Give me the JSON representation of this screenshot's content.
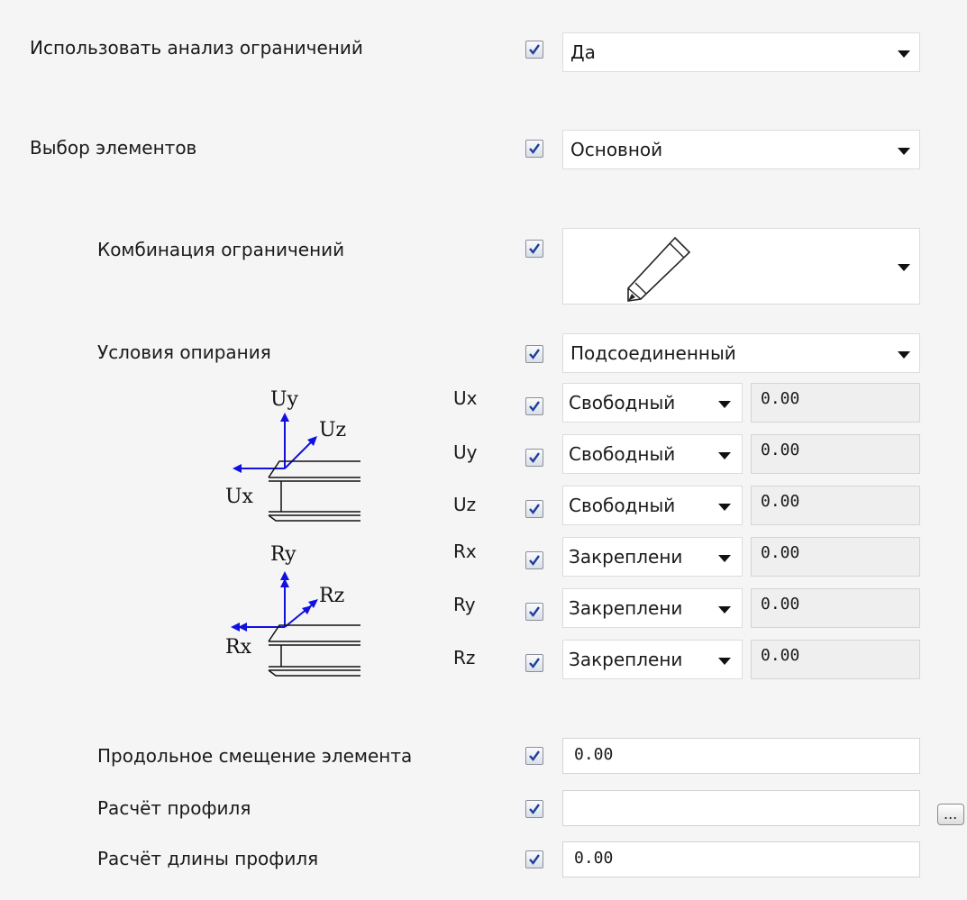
{
  "rows": {
    "use_analysis": {
      "label": "Использовать анализ ограничений",
      "value": "Да"
    },
    "element_selection": {
      "label": "Выбор элементов",
      "value": "Основной"
    },
    "restraint_combination": {
      "label": "Комбинация ограничений",
      "icon": "pencil-icon"
    },
    "support_conditions": {
      "label": "Условия опирания",
      "value": "Подсоединенный"
    },
    "longitudinal_offset": {
      "label": "Продольное смещение элемента",
      "value": "0.00"
    },
    "profile_calc": {
      "label": "Расчёт профиля",
      "value": "",
      "button": "..."
    },
    "profile_length_calc": {
      "label": "Расчёт длины профиля",
      "value": "0.00"
    }
  },
  "dofs": [
    {
      "name": "Ux",
      "condition": "Свободный",
      "value": "0.00"
    },
    {
      "name": "Uy",
      "condition": "Свободный",
      "value": "0.00"
    },
    {
      "name": "Uz",
      "condition": "Свободный",
      "value": "0.00"
    },
    {
      "name": "Rx",
      "condition": "Закреплени",
      "value": "0.00"
    },
    {
      "name": "Ry",
      "condition": "Закреплени",
      "value": "0.00"
    },
    {
      "name": "Rz",
      "condition": "Закреплени",
      "value": "0.00"
    }
  ],
  "diagram": {
    "translation": {
      "up": "Uy",
      "diag": "Uz",
      "left": "Ux"
    },
    "rotation": {
      "up": "Ry",
      "diag": "Rz",
      "left": "Rx"
    }
  },
  "colors": {
    "axis_arrow": "#1010e0",
    "check": "#1c3f9c"
  }
}
